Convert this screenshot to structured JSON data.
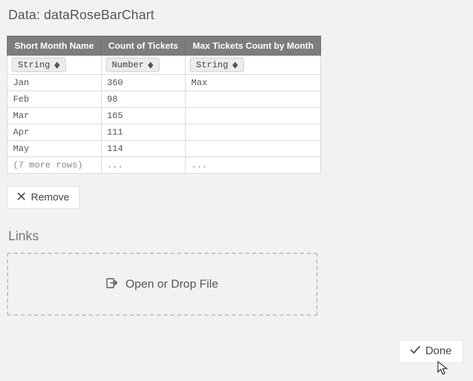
{
  "title_prefix": "Data: ",
  "title_name": "dataRoseBarChart",
  "columns": [
    {
      "header": "Short Month Name",
      "type": "String"
    },
    {
      "header": "Count of Tickets",
      "type": "Number"
    },
    {
      "header": "Max Tickets Count by Month",
      "type": "String"
    }
  ],
  "rows": [
    {
      "c0": "Jan",
      "c1": "360",
      "c2": "Max"
    },
    {
      "c0": "Feb",
      "c1": "98",
      "c2": ""
    },
    {
      "c0": "Mar",
      "c1": "165",
      "c2": ""
    },
    {
      "c0": "Apr",
      "c1": "111",
      "c2": ""
    },
    {
      "c0": "May",
      "c1": "114",
      "c2": ""
    }
  ],
  "more_row": {
    "c0": "(7 more rows)",
    "c1": "...",
    "c2": "..."
  },
  "remove_label": "Remove",
  "links_heading": "Links",
  "dropzone_label": "Open or Drop File",
  "done_label": "Done"
}
